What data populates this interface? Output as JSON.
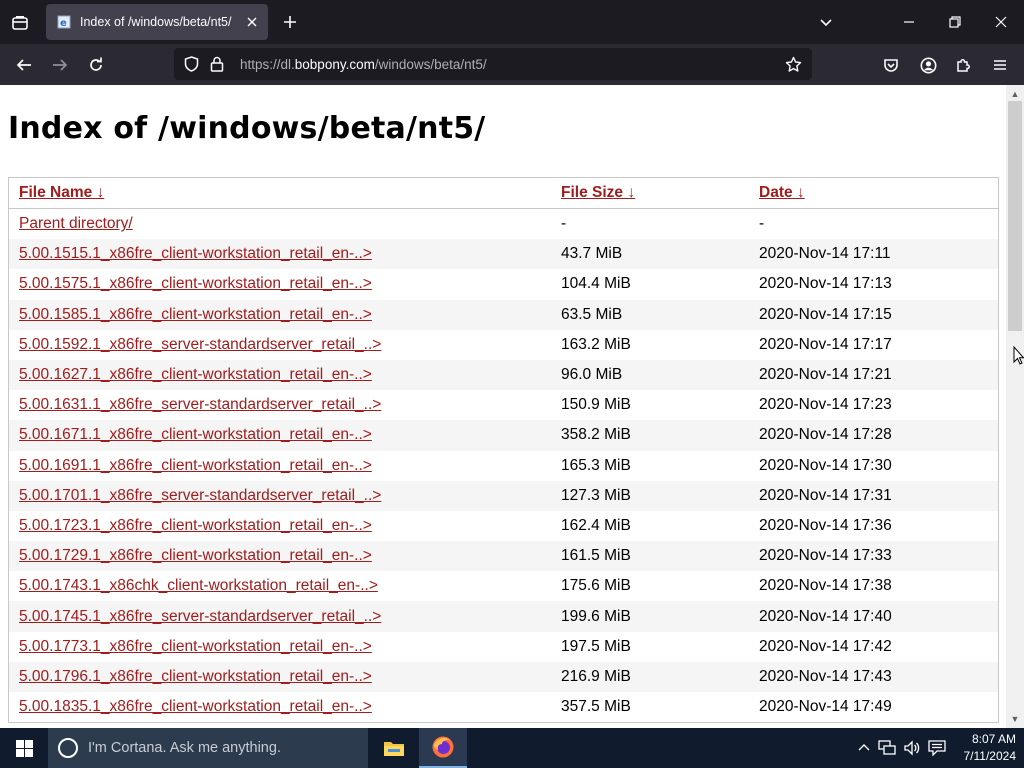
{
  "browser": {
    "tab": {
      "title": "Index of /windows/beta/nt5/"
    },
    "url": {
      "prefix": "https://dl.",
      "host": "bobpony.com",
      "path": "/windows/beta/nt5/"
    }
  },
  "page": {
    "title": "Index of /windows/beta/nt5/",
    "headers": {
      "name": "File Name  ↓",
      "size": "File Size  ↓",
      "date": "Date  ↓"
    },
    "parent": {
      "name": "Parent directory/",
      "size": "-",
      "date": "-"
    },
    "rows": [
      {
        "name": "5.00.1515.1_x86fre_client-workstation_retail_en-..>",
        "size": "43.7 MiB",
        "date": "2020-Nov-14 17:11"
      },
      {
        "name": "5.00.1575.1_x86fre_client-workstation_retail_en-..>",
        "size": "104.4 MiB",
        "date": "2020-Nov-14 17:13"
      },
      {
        "name": "5.00.1585.1_x86fre_client-workstation_retail_en-..>",
        "size": "63.5 MiB",
        "date": "2020-Nov-14 17:15"
      },
      {
        "name": "5.00.1592.1_x86fre_server-standardserver_retail_..>",
        "size": "163.2 MiB",
        "date": "2020-Nov-14 17:17"
      },
      {
        "name": "5.00.1627.1_x86fre_client-workstation_retail_en-..>",
        "size": "96.0 MiB",
        "date": "2020-Nov-14 17:21"
      },
      {
        "name": "5.00.1631.1_x86fre_server-standardserver_retail_..>",
        "size": "150.9 MiB",
        "date": "2020-Nov-14 17:23"
      },
      {
        "name": "5.00.1671.1_x86fre_client-workstation_retail_en-..>",
        "size": "358.2 MiB",
        "date": "2020-Nov-14 17:28"
      },
      {
        "name": "5.00.1691.1_x86fre_client-workstation_retail_en-..>",
        "size": "165.3 MiB",
        "date": "2020-Nov-14 17:30"
      },
      {
        "name": "5.00.1701.1_x86fre_server-standardserver_retail_..>",
        "size": "127.3 MiB",
        "date": "2020-Nov-14 17:31"
      },
      {
        "name": "5.00.1723.1_x86fre_client-workstation_retail_en-..>",
        "size": "162.4 MiB",
        "date": "2020-Nov-14 17:36"
      },
      {
        "name": "5.00.1729.1_x86fre_client-workstation_retail_en-..>",
        "size": "161.5 MiB",
        "date": "2020-Nov-14 17:33"
      },
      {
        "name": "5.00.1743.1_x86chk_client-workstation_retail_en-..>",
        "size": "175.6 MiB",
        "date": "2020-Nov-14 17:38"
      },
      {
        "name": "5.00.1745.1_x86fre_server-standardserver_retail_..>",
        "size": "199.6 MiB",
        "date": "2020-Nov-14 17:40"
      },
      {
        "name": "5.00.1773.1_x86fre_client-workstation_retail_en-..>",
        "size": "197.5 MiB",
        "date": "2020-Nov-14 17:42"
      },
      {
        "name": "5.00.1796.1_x86fre_client-workstation_retail_en-..>",
        "size": "216.9 MiB",
        "date": "2020-Nov-14 17:43"
      },
      {
        "name": "5.00.1835.1_x86fre_client-workstation_retail_en-..>",
        "size": "357.5 MiB",
        "date": "2020-Nov-14 17:49"
      }
    ]
  },
  "taskbar": {
    "search_placeholder": "I'm Cortana. Ask me anything.",
    "time": "8:07 AM",
    "date": "7/11/2024"
  },
  "colors": {
    "link": "#a11c1c",
    "browser_chrome": "#1c1b22",
    "taskbar": "#101c2e"
  },
  "icons": {
    "tab_list": "tab-list-icon",
    "favicon": "ie-page-icon",
    "back": "back-arrow-icon",
    "forward": "forward-arrow-icon",
    "reload": "reload-icon",
    "tracking": "shield-icon",
    "secure": "lock-icon",
    "bookmark": "star-icon",
    "pocket": "pocket-icon",
    "account": "account-icon",
    "extensions": "puzzle-icon",
    "menu": "hamburger-menu-icon"
  }
}
